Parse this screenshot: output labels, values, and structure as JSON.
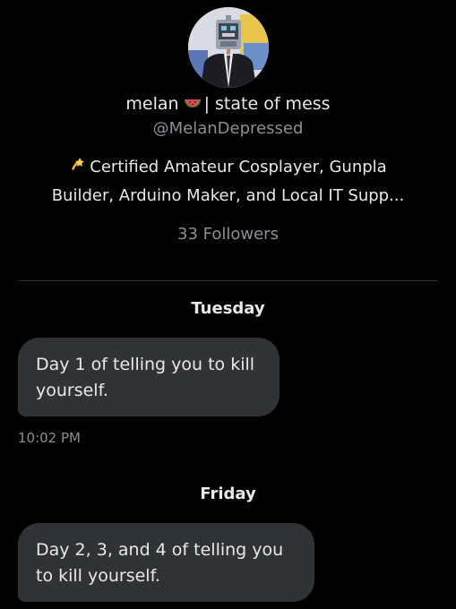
{
  "profile": {
    "display_name": "melan",
    "display_name_suffix": "| state of mess",
    "name_emoji_icon": "watermelon-icon",
    "handle": "@MelanDepressed",
    "bio_icon": "dizzy-star-icon",
    "bio_lines": [
      "Certified Amateur Cosplayer, Gunpla",
      "Builder, Arduino Maker, and  Local IT Supp..."
    ],
    "followers": "33 Followers"
  },
  "conversation": {
    "groups": [
      {
        "day_label": "Tuesday",
        "message_lines": [
          "Day 1 of telling you to kill",
          "yourself."
        ],
        "timestamp": "10:02 PM"
      },
      {
        "day_label": "Friday",
        "message_lines": [
          "Day 2, 3, and 4 of telling you",
          "to kill yourself."
        ]
      }
    ]
  },
  "colors": {
    "background": "#000000",
    "primary_text": "#e7e9ea",
    "secondary_text": "#8b9096",
    "bubble": "#2f3336",
    "divider": "#2f3336"
  }
}
